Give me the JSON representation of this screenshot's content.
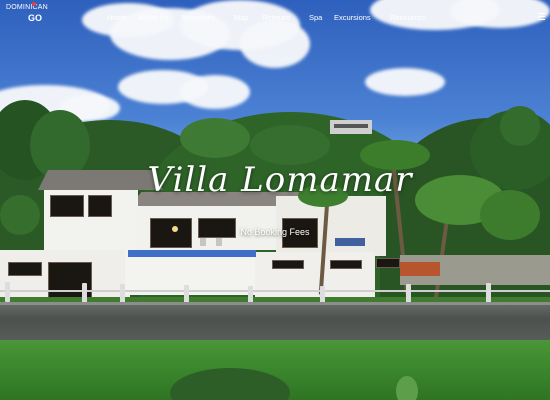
{
  "header": {
    "logo_top": "DOMINICAN",
    "logo_bottom": "GO",
    "menu": [
      "Home",
      "About Us",
      "Properties",
      "Map",
      "Retreats",
      "Spa",
      "Excursions",
      "Resources"
    ],
    "menu_icon": "hamburger-menu-icon"
  },
  "hero": {
    "title": "Villa Lomamar",
    "subtitle": "No Booking Fees"
  },
  "colors": {
    "sky": "#3f74c9",
    "text": "#ffffff",
    "grass": "#3d8a2e",
    "villa_wall": "#f2f2ef",
    "stone_wall": "#545855",
    "pool": "#3f6fc7"
  }
}
